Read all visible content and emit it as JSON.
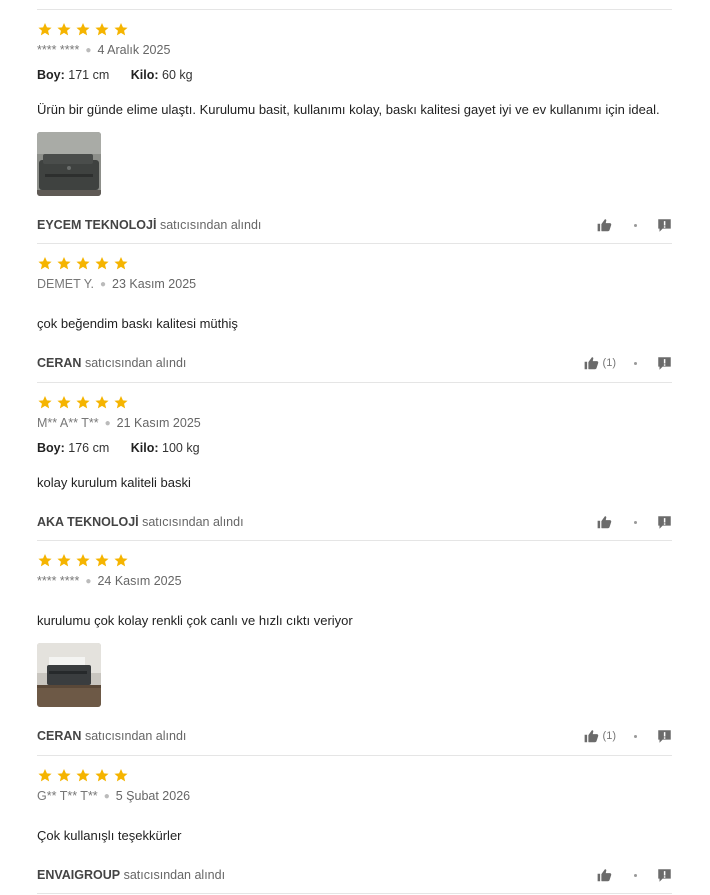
{
  "reviews": [
    {
      "rating": 5,
      "author": "**** ****",
      "date": "4 Aralık 2025",
      "boy_label": "Boy:",
      "boy": "171 cm",
      "kilo_label": "Kilo:",
      "kilo": "60 kg",
      "text": "Ürün bir günde elime ulaştı. Kurulumu basit, kullanımı kolay, baskı kalitesi gayet iyi ve ev kullanımı için ideal.",
      "has_photo": true,
      "seller": "EYCEM TEKNOLOJİ",
      "seller_suffix": "satıcısından alındı",
      "likes": ""
    },
    {
      "rating": 5,
      "author": "DEMET Y.",
      "date": "23 Kasım 2025",
      "text": "çok beğendim baskı kalitesi müthiş",
      "has_photo": false,
      "seller": "CERAN",
      "seller_suffix": "satıcısından alındı",
      "likes": "(1)"
    },
    {
      "rating": 5,
      "author": "M** A** T**",
      "date": "21 Kasım 2025",
      "boy_label": "Boy:",
      "boy": "176 cm",
      "kilo_label": "Kilo:",
      "kilo": "100 kg",
      "text": "kolay kurulum kaliteli baski",
      "has_photo": false,
      "seller": "AKA TEKNOLOJİ",
      "seller_suffix": "satıcısından alındı",
      "likes": ""
    },
    {
      "rating": 5,
      "author": "**** ****",
      "date": "24 Kasım 2025",
      "text": "kurulumu çok kolay renkli çok canlı ve hızlı cıktı veriyor",
      "has_photo": true,
      "seller": "CERAN",
      "seller_suffix": "satıcısından alındı",
      "likes": "(1)"
    },
    {
      "rating": 5,
      "author": "G** T** T**",
      "date": "5 Şubat 2026",
      "text": "Çok kullanışlı teşekkürler",
      "has_photo": false,
      "seller": "ENVAIGROUP",
      "seller_suffix": "satıcısından alındı",
      "likes": ""
    }
  ],
  "colors": {
    "star": "#f5b400",
    "divider": "#e5e5e5",
    "icon": "#6b6b6b"
  },
  "icons": {
    "star": "star-icon",
    "like": "thumbs-up-icon",
    "report": "report-flag-icon"
  }
}
